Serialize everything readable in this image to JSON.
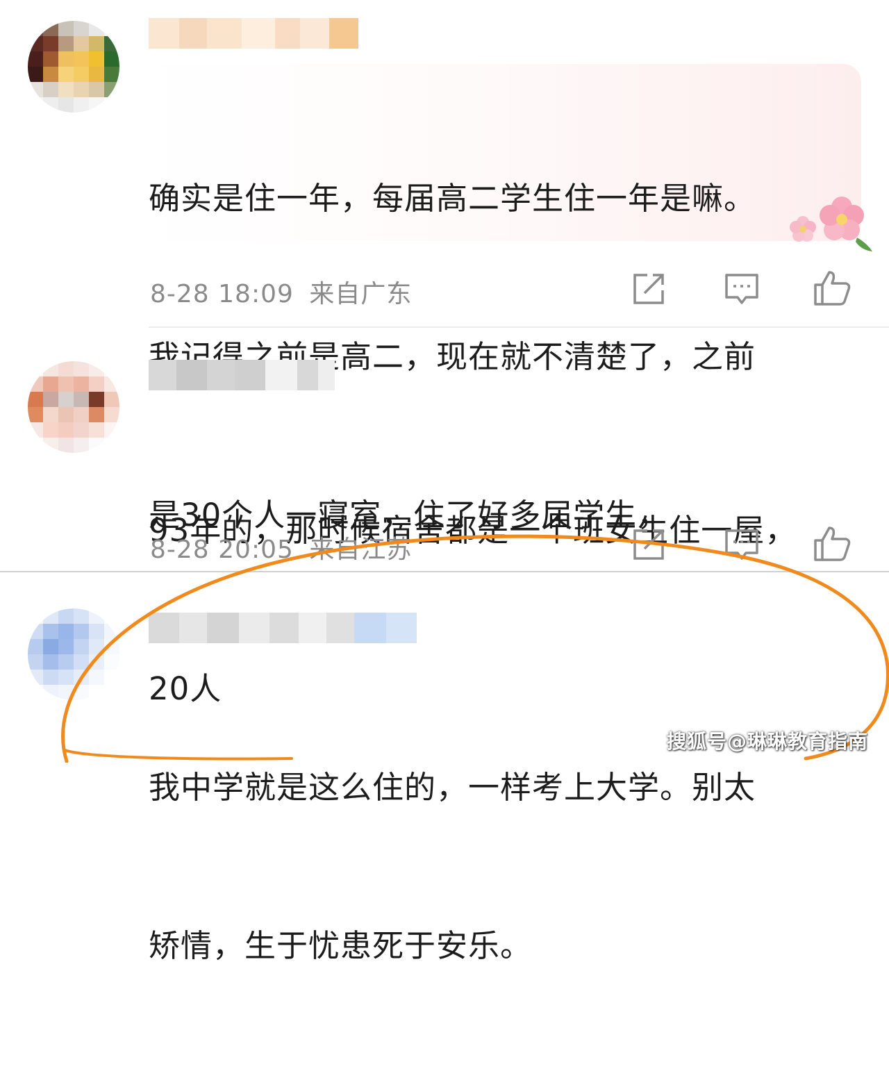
{
  "comments": [
    {
      "text_line1": "确实是住一年，每届高二学生住一年是嘛。",
      "text_line2": "我记得之前是高二，现在就不清楚了，之前",
      "text_line3": "是30个人一寝室，住了好多届学生，",
      "time": "8-28 18:09",
      "location": "来自广东"
    },
    {
      "text_line1": "93年的，那时候宿舍都是一个班女生住一屋，",
      "text_line2": "20人",
      "time": "8-28 20:05",
      "location": "来自江苏"
    },
    {
      "text_line1": "我中学就是这么住的，一样考上大学。别太",
      "text_line2": "矫情，生于忧患死于安乐。"
    }
  ],
  "icons": [
    "share-icon",
    "comment-icon",
    "like-icon"
  ],
  "watermark": "搜狐号@琳琳教育指南",
  "colors": {
    "highlight": "#f08a1c",
    "meta_text": "#8a8a8a",
    "icon_stroke": "#8c8c8c"
  }
}
